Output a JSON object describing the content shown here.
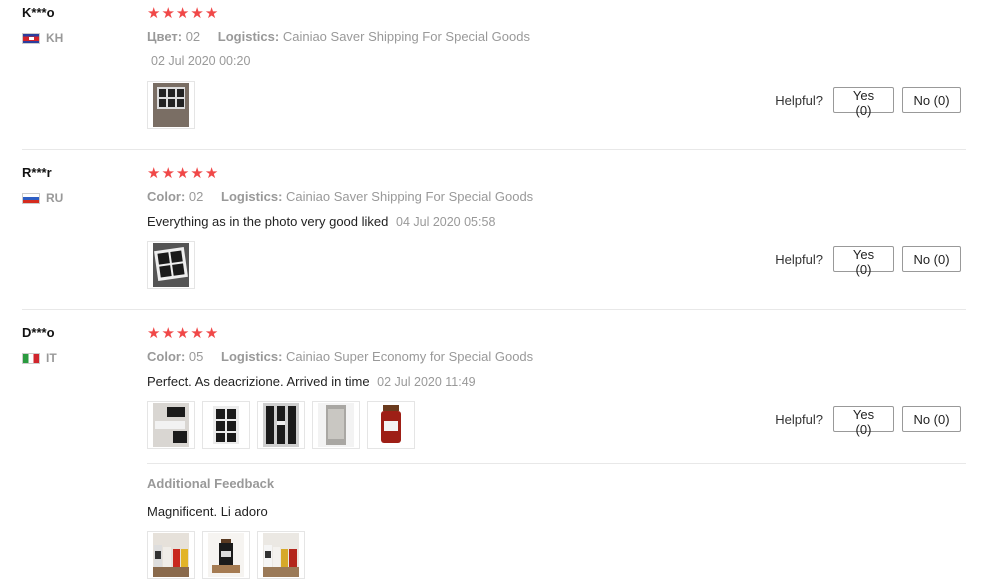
{
  "reviews": [
    {
      "user": "K***o",
      "country": "KH",
      "stars": 5,
      "color_key": "Цвет:",
      "color_val": "02",
      "logistics_key": "Logistics:",
      "logistics_val": "Cainiao Saver Shipping For Special Goods",
      "text": "",
      "date": "02 Jul 2020 00:20",
      "helpful_label": "Helpful?",
      "yes_label": "Yes (0)",
      "no_label": "No (0)"
    },
    {
      "user": "R***r",
      "country": "RU",
      "stars": 5,
      "color_key": "Color:",
      "color_val": "02",
      "logistics_key": "Logistics:",
      "logistics_val": "Cainiao Saver Shipping For Special Goods",
      "text": "Everything as in the photo very good liked",
      "date": "04 Jul 2020 05:58",
      "helpful_label": "Helpful?",
      "yes_label": "Yes (0)",
      "no_label": "No (0)"
    },
    {
      "user": "D***o",
      "country": "IT",
      "stars": 5,
      "color_key": "Color:",
      "color_val": "05",
      "logistics_key": "Logistics:",
      "logistics_val": "Cainiao Super Economy for Special Goods",
      "text": "Perfect. As deacrizione. Arrived in time",
      "date": "02 Jul 2020 11:49",
      "helpful_label": "Helpful?",
      "yes_label": "Yes (0)",
      "no_label": "No (0)",
      "additional_title": "Additional Feedback",
      "additional_text": "Magnificent. Li adoro"
    }
  ],
  "icons": {
    "star": "★"
  },
  "colors": {
    "star": "#f04848",
    "muted": "#999999"
  }
}
